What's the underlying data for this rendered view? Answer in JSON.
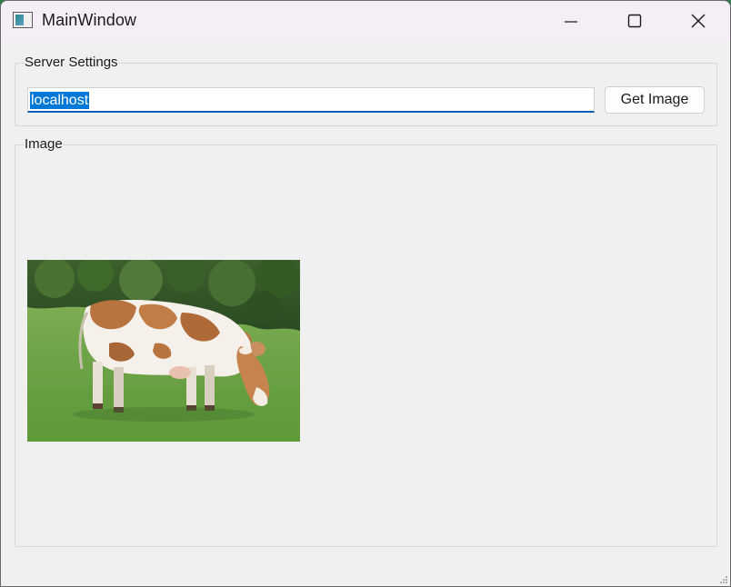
{
  "window": {
    "title": "MainWindow"
  },
  "server_settings": {
    "title": "Server Settings",
    "host_value": "localhost",
    "get_image_label": "Get Image"
  },
  "image_panel": {
    "title": "Image",
    "image_icon": "grazing-cow-photo"
  },
  "colors": {
    "titlebar": "#f5eef6",
    "window_bg": "#f0f0f0",
    "selection": "#0078d7",
    "input_underline": "#0a5fb4"
  }
}
